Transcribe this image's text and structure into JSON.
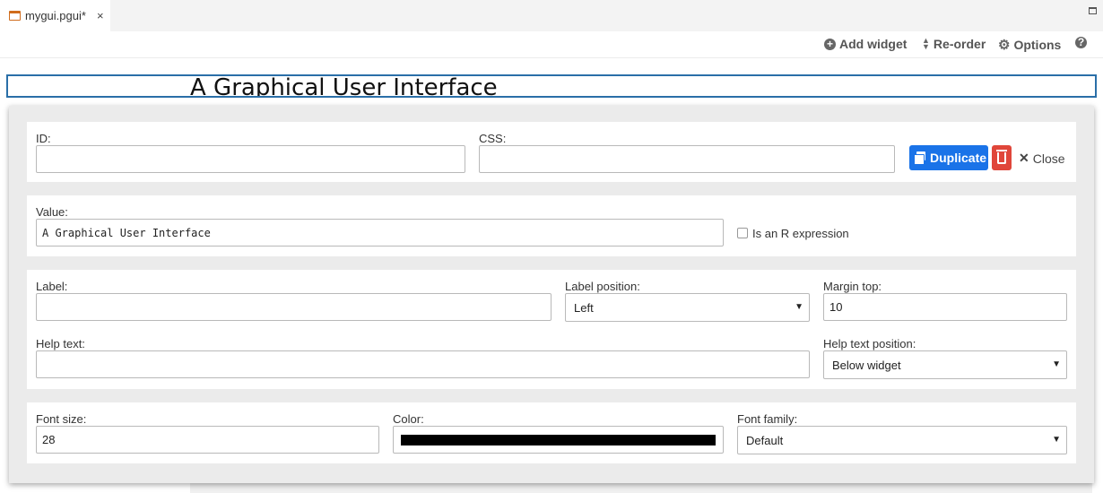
{
  "tab": {
    "title": "mygui.pgui*",
    "close": "×"
  },
  "toolbar": {
    "add_widget": "Add widget",
    "reorder": "Re-order",
    "options": "Options",
    "help": "?"
  },
  "preview": {
    "title": "A Graphical User Interface"
  },
  "editor": {
    "id": {
      "label": "ID:",
      "value": ""
    },
    "css": {
      "label": "CSS:",
      "value": ""
    },
    "duplicate_label": "Duplicate",
    "close_label": "Close",
    "value": {
      "label": "Value:",
      "value": "A Graphical User Interface"
    },
    "r_expression": {
      "label": "Is an R expression",
      "checked": false
    },
    "label": {
      "label": "Label:",
      "value": ""
    },
    "label_position": {
      "label": "Label position:",
      "value": "Left"
    },
    "margin_top": {
      "label": "Margin top:",
      "value": "10"
    },
    "help_text": {
      "label": "Help text:",
      "value": ""
    },
    "help_text_position": {
      "label": "Help text position:",
      "value": "Below widget"
    },
    "font_size": {
      "label": "Font size:",
      "value": "28"
    },
    "color": {
      "label": "Color:",
      "value": "#000000"
    },
    "font_family": {
      "label": "Font family:",
      "value": "Default"
    }
  },
  "colors": {
    "accent": "#1a73e8",
    "danger": "#e0463a",
    "frame": "#2a6fa8",
    "file_icon": "#d06c1c"
  }
}
